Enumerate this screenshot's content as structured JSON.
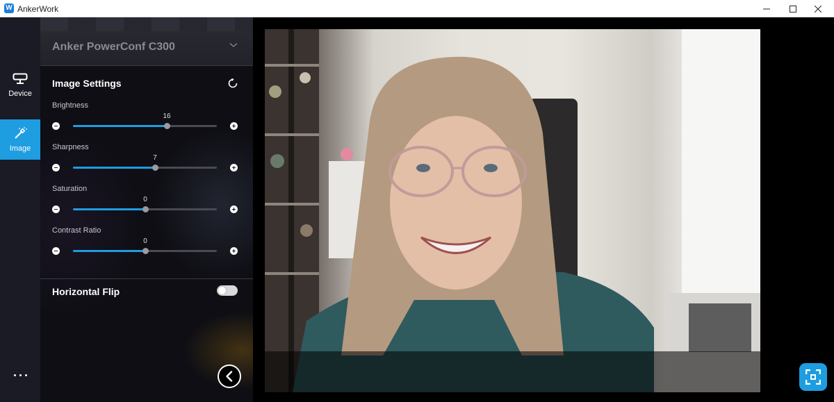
{
  "window": {
    "title": "AnkerWork",
    "logo_glyph": "W"
  },
  "nav": {
    "items": [
      {
        "label": "Device",
        "icon": "webcam-icon"
      },
      {
        "label": "Image",
        "icon": "magic-wand-icon",
        "active": true
      }
    ],
    "more_icon": "more-dots-icon"
  },
  "panel": {
    "device_name": "Anker PowerConf C300",
    "image_settings_title": "Image Settings",
    "sliders": [
      {
        "label": "Brightness",
        "value": "16",
        "fraction": 0.65
      },
      {
        "label": "Sharpness",
        "value": "7",
        "fraction": 0.57
      },
      {
        "label": "Saturation",
        "value": "0",
        "fraction": 0.5
      },
      {
        "label": "Contrast Ratio",
        "value": "0",
        "fraction": 0.5
      }
    ],
    "horizontal_flip_label": "Horizontal Flip",
    "horizontal_flip_on": false
  },
  "colors": {
    "accent": "#1e9de0",
    "nav_bg": "#1b1b25",
    "panel_bg": "#0e0e14"
  }
}
